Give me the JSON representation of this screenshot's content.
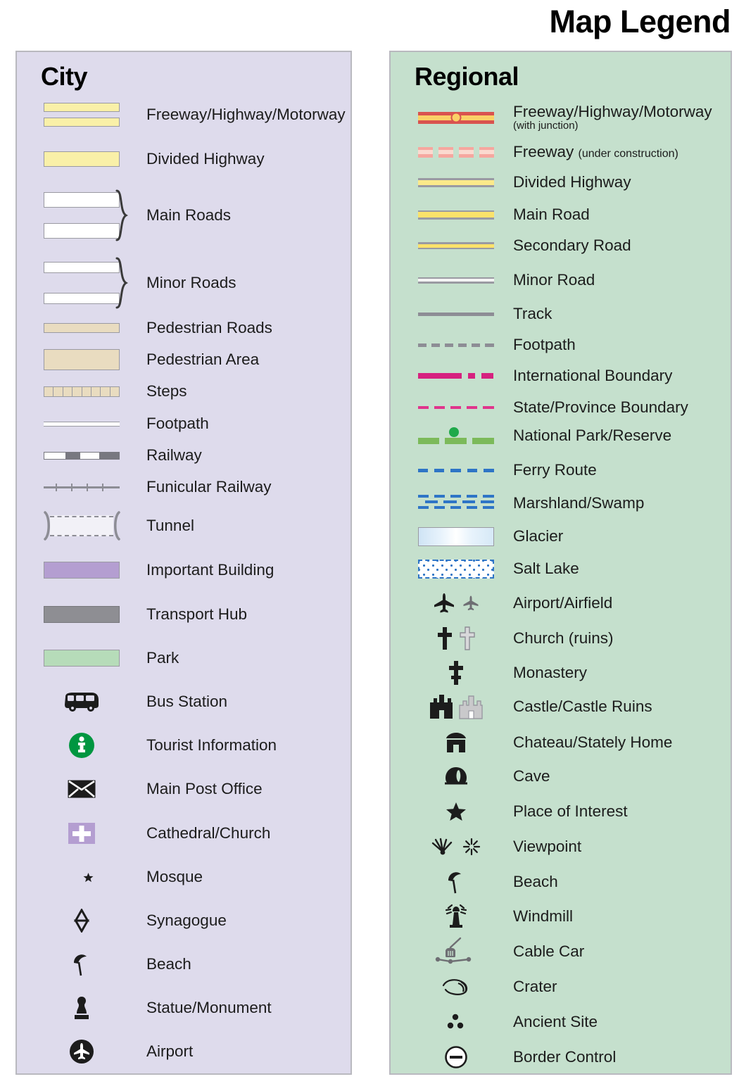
{
  "title": "Map Legend",
  "colors": {
    "city_panel_bg": "#dedbec",
    "regional_panel_bg": "#c5e0cd",
    "panel_border": "#b9b9bf",
    "highway_yellow": "#f9f0a8",
    "pedestrian_tan": "#e9dcc0",
    "important_building_purple": "#b49ed1",
    "transport_hub_grey": "#8e8e93",
    "park_green": "#b6dcb9",
    "tourist_info_green": "#009640",
    "freeway_red": "#d9534f",
    "freeway_yellow": "#fbd166",
    "international_boundary_pink": "#d6217f",
    "state_boundary_pink": "#e0348c",
    "national_park_green": "#7cba5a",
    "ferry_blue": "#2e75c6"
  },
  "city": {
    "heading": "City",
    "items": [
      {
        "label": "Freeway/Highway/Motorway",
        "symbol": "freeway-double-bar"
      },
      {
        "label": "Divided Highway",
        "symbol": "divided-highway-bar"
      },
      {
        "label": "Main Roads",
        "symbol": "main-roads-bracketed-pair"
      },
      {
        "label": "Minor Roads",
        "symbol": "minor-roads-bracketed-pair"
      },
      {
        "label": "Pedestrian Roads",
        "symbol": "pedestrian-road-bar"
      },
      {
        "label": "Pedestrian Area",
        "symbol": "pedestrian-area-block"
      },
      {
        "label": "Steps",
        "symbol": "steps-bar"
      },
      {
        "label": "Footpath",
        "symbol": "footpath-line"
      },
      {
        "label": "Railway",
        "symbol": "railway-hatched-line"
      },
      {
        "label": "Funicular Railway",
        "symbol": "funicular-ticked-line"
      },
      {
        "label": "Tunnel",
        "symbol": "tunnel-bracket"
      },
      {
        "label": "Important Building",
        "symbol": "important-building-block"
      },
      {
        "label": "Transport Hub",
        "symbol": "transport-hub-block"
      },
      {
        "label": "Park",
        "symbol": "park-block"
      },
      {
        "label": "Bus Station",
        "symbol": "bus-icon"
      },
      {
        "label": "Tourist Information",
        "symbol": "information-circle-icon"
      },
      {
        "label": "Main Post Office",
        "symbol": "envelope-icon"
      },
      {
        "label": "Cathedral/Church",
        "symbol": "cross-on-purple-icon"
      },
      {
        "label": "Mosque",
        "symbol": "crescent-star-icon"
      },
      {
        "label": "Synagogue",
        "symbol": "star-of-david-icon"
      },
      {
        "label": "Beach",
        "symbol": "beach-umbrella-icon"
      },
      {
        "label": "Statue/Monument",
        "symbol": "statue-icon"
      },
      {
        "label": "Airport",
        "symbol": "airplane-circle-icon"
      }
    ]
  },
  "regional": {
    "heading": "Regional",
    "items": [
      {
        "label": "Freeway/Highway/Motorway",
        "sub": "(with junction)",
        "symbol": "freeway-junction-line"
      },
      {
        "label": "Freeway",
        "inline_sub": "(under construction)",
        "symbol": "freeway-construction-dashes"
      },
      {
        "label": "Divided Highway",
        "symbol": "divided-highway-dashed-line"
      },
      {
        "label": "Main Road",
        "symbol": "main-road-line"
      },
      {
        "label": "Secondary Road",
        "symbol": "secondary-road-line"
      },
      {
        "label": "Minor Road",
        "symbol": "minor-road-line"
      },
      {
        "label": "Track",
        "symbol": "track-line"
      },
      {
        "label": "Footpath",
        "symbol": "footpath-dashed-line"
      },
      {
        "label": "International Boundary",
        "symbol": "international-boundary-line"
      },
      {
        "label": "State/Province Boundary",
        "symbol": "state-boundary-dashed-line"
      },
      {
        "label": "National Park/Reserve",
        "symbol": "national-park-line"
      },
      {
        "label": "Ferry Route",
        "symbol": "ferry-route-dashed-line"
      },
      {
        "label": "Marshland/Swamp",
        "symbol": "marshland-pattern"
      },
      {
        "label": "Glacier",
        "symbol": "glacier-block"
      },
      {
        "label": "Salt Lake",
        "symbol": "salt-lake-block"
      },
      {
        "label": "Airport/Airfield",
        "symbol": "airplane-pair-icon"
      },
      {
        "label": "Church (ruins)",
        "symbol": "cross-pair-icon"
      },
      {
        "label": "Monastery",
        "symbol": "monastery-cross-icon"
      },
      {
        "label": "Castle/Castle Ruins",
        "symbol": "castle-pair-icon"
      },
      {
        "label": "Chateau/Stately Home",
        "symbol": "chateau-icon"
      },
      {
        "label": "Cave",
        "symbol": "cave-icon"
      },
      {
        "label": "Place of Interest",
        "symbol": "star-icon"
      },
      {
        "label": "Viewpoint",
        "symbol": "viewpoint-pair-icon"
      },
      {
        "label": "Beach",
        "symbol": "beach-umbrella-icon"
      },
      {
        "label": "Windmill",
        "symbol": "windmill-icon"
      },
      {
        "label": "Cable Car",
        "symbol": "cable-car-icon"
      },
      {
        "label": "Crater",
        "symbol": "crater-icon"
      },
      {
        "label": "Ancient Site",
        "symbol": "ancient-site-dots-icon"
      },
      {
        "label": "Border Control",
        "symbol": "border-control-icon"
      }
    ]
  }
}
